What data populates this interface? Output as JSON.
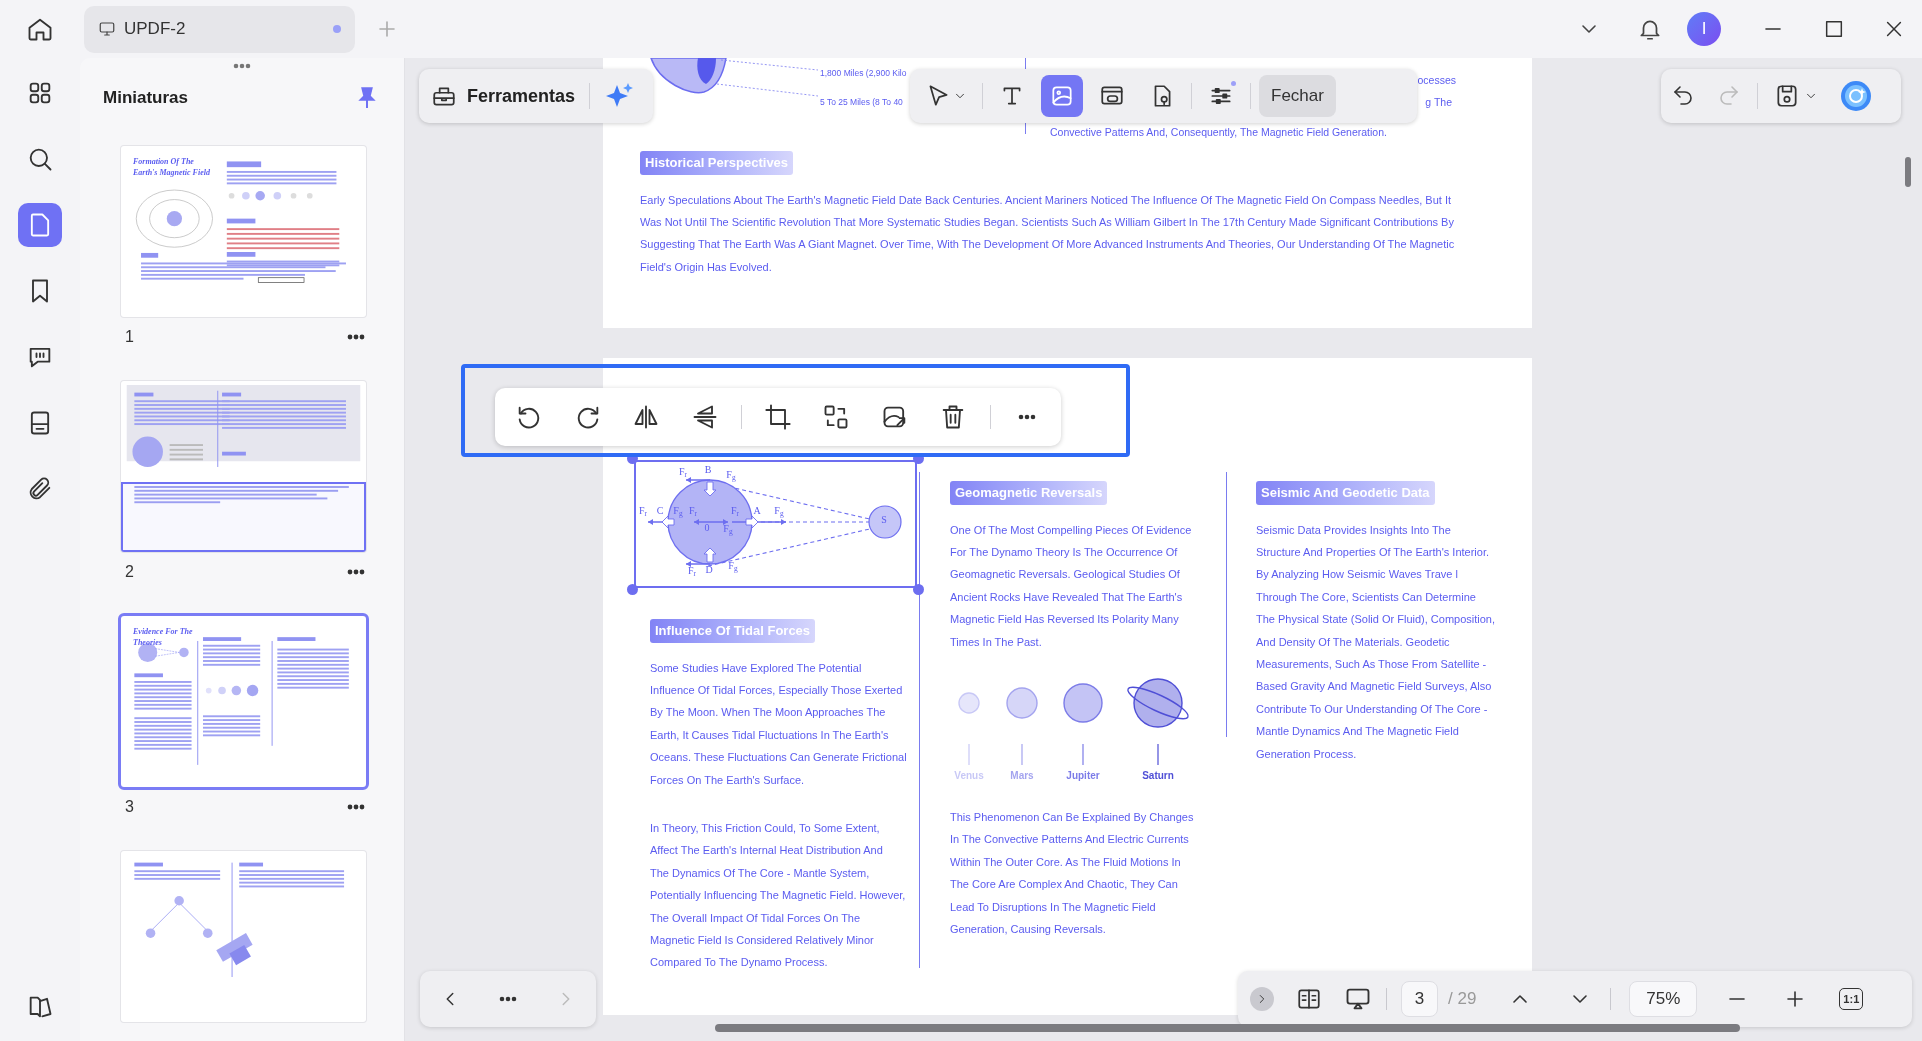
{
  "tab": {
    "title": "UPDF-2",
    "unsaved": true
  },
  "account": {
    "initial": "I"
  },
  "rail": [
    {
      "kind": "grid",
      "selected": false
    },
    {
      "kind": "search",
      "selected": false
    },
    {
      "kind": "page",
      "selected": true
    },
    {
      "kind": "bookmark",
      "selected": false
    },
    {
      "kind": "comment",
      "selected": false
    },
    {
      "kind": "form",
      "selected": false
    },
    {
      "kind": "attachment",
      "selected": false
    }
  ],
  "panel": {
    "title": "Miniaturas",
    "pinned": true
  },
  "thumbnails": [
    {
      "number": "1",
      "kind": "title-page",
      "heading": "Formation Of The\nEarth's Magnetic Field",
      "selected": false,
      "in_view": false
    },
    {
      "number": "2",
      "kind": "two-column",
      "selected": false,
      "in_view": true
    },
    {
      "number": "3",
      "kind": "three-column",
      "heading": "Evidence For The Theories",
      "selected": true,
      "in_view": false
    },
    {
      "kind": "diagram",
      "selected": false,
      "in_view": false
    }
  ],
  "tools": {
    "label": "Ferramentas"
  },
  "edit_toolbar": {
    "items": [
      {
        "kind": "select",
        "selected": false
      },
      {
        "kind": "text",
        "selected": false
      },
      {
        "kind": "image",
        "selected": true
      },
      {
        "kind": "link",
        "selected": false
      },
      {
        "kind": "location",
        "selected": false
      },
      {
        "kind": "properties",
        "selected": false
      }
    ],
    "close": "Fechar"
  },
  "history": {
    "undo": {
      "disabled": false
    },
    "redo": {
      "disabled": true
    }
  },
  "image_toolbar": [
    {
      "kind": "rotate-left"
    },
    {
      "kind": "rotate-right"
    },
    {
      "kind": "flip-horizontal"
    },
    {
      "kind": "flip-vertical"
    },
    {
      "kind": "separator"
    },
    {
      "kind": "crop"
    },
    {
      "kind": "replace"
    },
    {
      "kind": "extract"
    },
    {
      "kind": "delete"
    },
    {
      "kind": "separator"
    },
    {
      "kind": "more"
    }
  ],
  "top_page": {
    "diagram_labels": [
      "1,800 Miles (2,900 Kilo",
      "5 To 25 Miles (8 To 40"
    ],
    "column_fragments": [
      "ocesses",
      "g The",
      "Convective Patterns And, Consequently, The Magnetic Field Generation."
    ],
    "heading": "Historical Perspectives",
    "paragraph": "Early Speculations About The Earth's Magnetic Field Date Back Centuries. Ancient Mariners Noticed The Influence Of The Magnetic Field On Compass Needles, But It\nWas Not Until The Scientific Revolution That More Systematic Studies Began. Scientists Such As William Gilbert In The 17th Century Made Significant Contributions By\nSuggesting That The Earth Was A Giant Magnet. Over Time, With The Development Of More Advanced Instruments And Theories, Our Understanding Of The Magnetic\nField's Origin Has Evolved."
  },
  "current_page": {
    "columns": [
      {
        "blocks": [
          {
            "kind": "figure",
            "selected": true,
            "labels": [
              "F$_{r}$",
              "B",
              "F$_{g}$",
              "F$_{r}$",
              "C",
              "F$_{g}$",
              "F$_{r}$",
              "F$_{r}$",
              "A",
              "F$_{g}$",
              "0",
              "F$_{g}$",
              "F$_{r}$",
              "D",
              "F$_{g}$",
              "S"
            ]
          },
          {
            "kind": "heading",
            "text": "Influence Of Tidal Forces"
          },
          {
            "kind": "paragraph",
            "text": "Some Studies Have Explored The Potential\nInfluence Of Tidal Forces, Especially Those Exerted\nBy The Moon. When The Moon Approaches The\nEarth, It Causes Tidal Fluctuations In The Earth's\nOceans. These Fluctuations Can Generate Frictional\nForces On The Earth's Surface."
          },
          {
            "kind": "paragraph",
            "text": "In Theory, This Friction Could, To Some Extent,\nAffect The Earth's Internal Heat Distribution And\nThe Dynamics Of The Core - Mantle System,\nPotentially Influencing The Magnetic Field. However,\nThe Overall Impact Of Tidal Forces On The\nMagnetic Field Is Considered Relatively Minor\nCompared To The Dynamo Process."
          }
        ]
      },
      {
        "blocks": [
          {
            "kind": "heading",
            "text": "Geomagnetic Reversals"
          },
          {
            "kind": "paragraph",
            "text": "One Of The Most Compelling Pieces Of Evidence\nFor The Dynamo Theory Is The Occurrence Of\nGeomagnetic Reversals. Geological Studies Of\nAncient Rocks Have Revealed That The Earth's\nMagnetic Field Has Reversed Its Polarity Many\nTimes In The Past."
          },
          {
            "kind": "planets",
            "items": [
              {
                "name": "Venus",
                "kind": "plain",
                "color": "#c8c8f6"
              },
              {
                "name": "Mars",
                "kind": "plain",
                "color": "#a4a4ef"
              },
              {
                "name": "Jupiter",
                "kind": "plain",
                "color": "#7c7ce8"
              },
              {
                "name": "Saturn",
                "kind": "ringed",
                "color": "#4f4fd6"
              }
            ]
          },
          {
            "kind": "paragraph",
            "text": "This Phenomenon Can Be Explained By Changes\nIn The Convective Patterns And Electric Currents\nWithin The Outer Core. As The Fluid Motions In\nThe Core Are Complex And Chaotic, They Can\nLead To Disruptions In The Magnetic Field\nGeneration, Causing Reversals."
          }
        ]
      },
      {
        "blocks": [
          {
            "kind": "heading",
            "text": "Seismic And Geodetic Data"
          },
          {
            "kind": "paragraph",
            "text": "Seismic Data Provides Insights Into The\nStructure And Properties Of The Earth's Interior.\nBy Analyzing How Seismic Waves Trave l\nThrough The Core, Scientists Can Determine\nThe Physical State (Solid Or Fluid), Composition,\nAnd Density Of The Materials. Geodetic\nMeasurements, Such As Those From Satellite -\nBased Gravity And Magnetic Field Surveys, Also\nContribute To Our Understanding Of The Core -\nMantle Dynamics And The Magnetic Field\nGeneration Process."
          }
        ]
      }
    ]
  },
  "page_nav": {
    "previous": {
      "disabled": false
    },
    "next": {
      "disabled": true
    }
  },
  "status": {
    "page": "3",
    "total": "/ 29",
    "zoom": "75%",
    "actual_size": "1:1"
  }
}
